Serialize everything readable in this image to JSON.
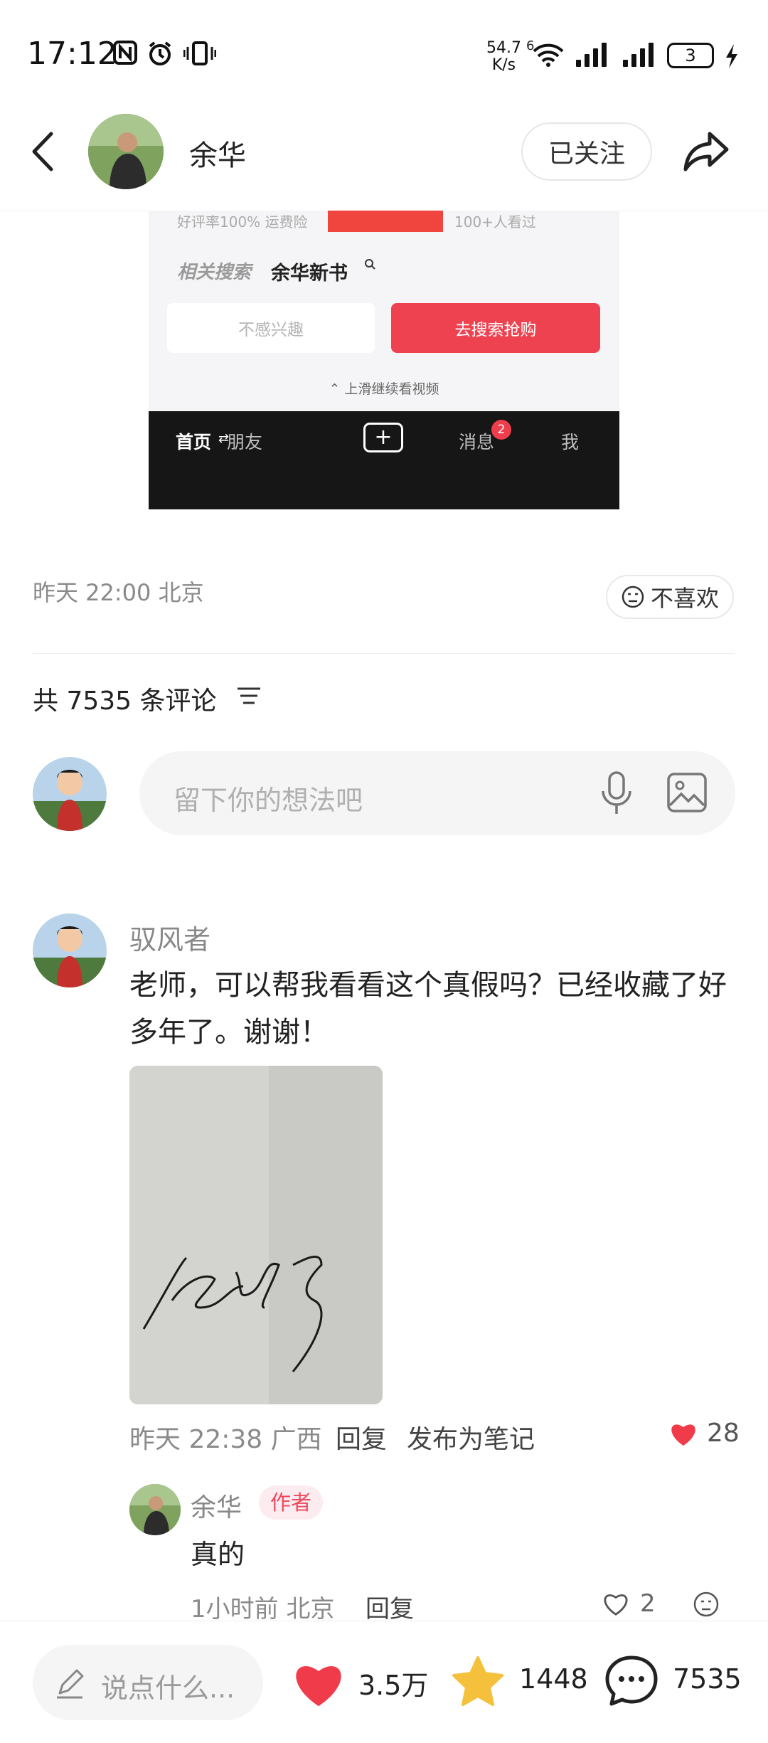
{
  "status_bar": {
    "time": "17:12",
    "net_speed_value": "54.7",
    "net_speed_unit": "K/s",
    "sim_label": "6",
    "battery": "3"
  },
  "header": {
    "author_name": "余华",
    "follow_label": "已关注"
  },
  "embedded_screenshot": {
    "top_text": "好评率100%  运费险",
    "top_count": "100+人看过",
    "related_label": "相关搜索",
    "related_term": "余华新书",
    "not_interested": "不感兴趣",
    "search_buy": "去搜索抢购",
    "scroll_hint": "上滑继续看视频",
    "nav": {
      "home": "首页",
      "friends": "朋友",
      "plus": "+",
      "messages": "消息",
      "messages_badge": "2",
      "me": "我"
    }
  },
  "post_meta": {
    "time_location": "昨天 22:00 北京",
    "dislike_label": "不喜欢"
  },
  "comments_section": {
    "count_text": "共 7535 条评论",
    "input_placeholder": "留下你的想法吧"
  },
  "comment": {
    "user": "驭风者",
    "text": "老师，可以帮我看看这个真假吗？已经收藏了好多年了。谢谢！",
    "time_location": "昨天 22:38 广西",
    "reply_label": "回复",
    "publish_label": "发布为笔记",
    "likes": "28"
  },
  "reply": {
    "user": "余华",
    "author_tag": "作者",
    "text": "真的",
    "time_location": "1小时前 北京",
    "reply_label": "回复",
    "likes": "2"
  },
  "bottom_bar": {
    "input_placeholder": "说点什么...",
    "likes": "3.5万",
    "favorites": "1448",
    "comments": "7535"
  },
  "colors": {
    "heart_red": "#f03c4a",
    "star_yellow": "#f5c13c",
    "author_tag_bg": "#fdecef",
    "author_tag_text": "#f0485c"
  }
}
